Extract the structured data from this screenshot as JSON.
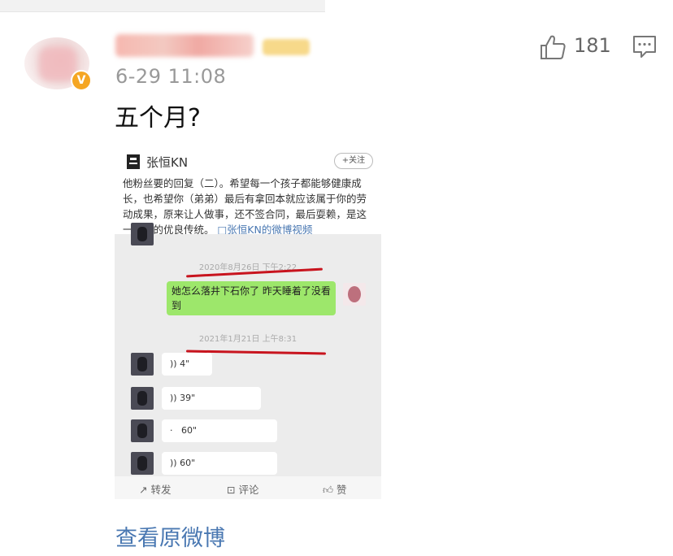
{
  "post": {
    "timestamp": "6-29 11:08",
    "content": "五个月?",
    "like_count": "181",
    "view_original_label": "查看原微博"
  },
  "icons": {
    "like": "thumbs-up-icon",
    "comment": "comment-icon",
    "verified": "verified-badge-icon"
  },
  "verified_badge": "V",
  "embedded": {
    "author": "张恒KN",
    "follow_label": "+关注",
    "text": "他粉丝要的回复（二）。希望每一个孩子都能够健康成长，也希望你（弟弟）最后有拿回本就应该属于你的劳动成果，原来让人做事，还不签合同，最后耍赖，是这一家人的优良传统。",
    "video_link": "□张恒KN的微博视频",
    "chat": {
      "timestamp1": "2020年8月26日 下午2:22",
      "message": "她怎么落井下石你了 昨天睡着了没看到",
      "timestamp2": "2021年1月21日 上午8:31",
      "voice_messages": [
        "4\"",
        "39\"",
        "60\"",
        "60\""
      ]
    },
    "footer": {
      "repost": "转发",
      "comment": "评论",
      "like": "赞"
    }
  },
  "colors": {
    "link": "#4a78b2",
    "bubble_green": "#9de76b",
    "annotation_red": "#c8141e",
    "badge_gold": "#f5a623"
  }
}
